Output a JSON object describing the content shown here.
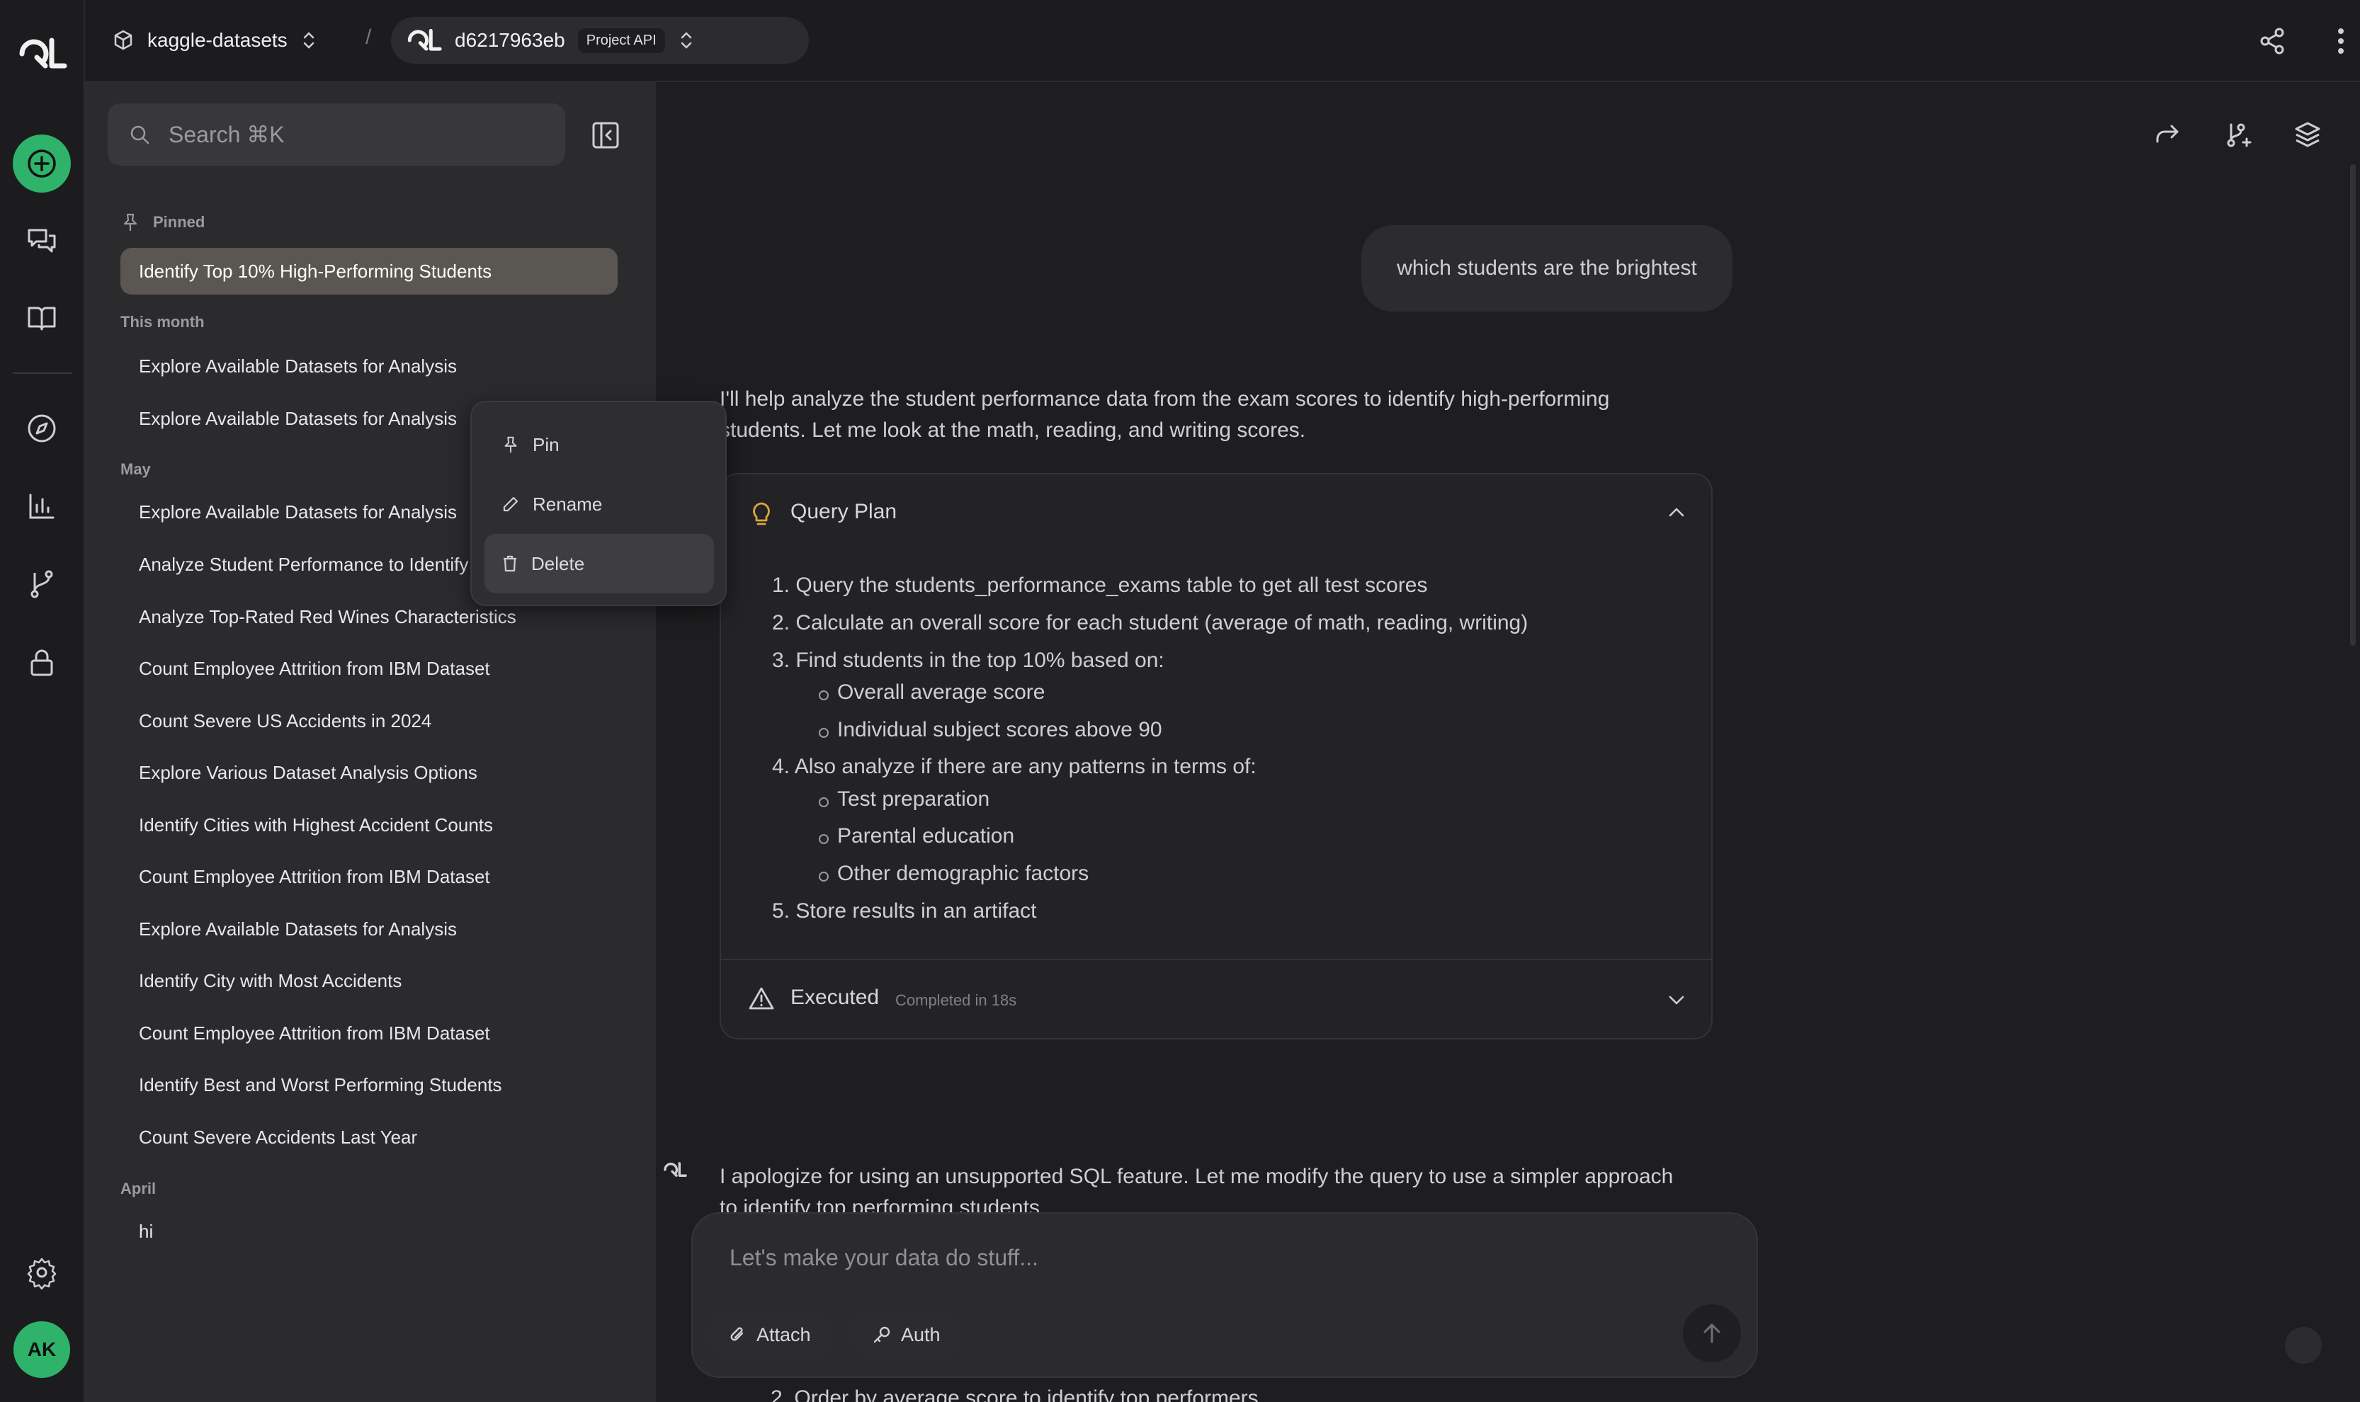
{
  "app": {
    "logo": "QL",
    "avatar_initials": "AK"
  },
  "topbar": {
    "project": "kaggle-datasets",
    "separator": "/",
    "connection_id": "d6217963eb",
    "connection_badge": "Project API"
  },
  "sidebar": {
    "search_placeholder": "Search ⌘K",
    "pinned_label": "Pinned",
    "pinned": [
      "Identify Top 10% High-Performing Students"
    ],
    "groups": [
      {
        "label": "This month",
        "items": [
          "Explore Available Datasets for Analysis",
          "Explore Available Datasets for Analysis"
        ]
      },
      {
        "label": "May",
        "items": [
          "Explore Available Datasets for Analysis",
          "Analyze Student Performance to Identify",
          "Analyze Top-Rated Red Wines Characteristics",
          "Count Employee Attrition from IBM Dataset",
          "Count Severe US Accidents in 2024",
          "Explore Various Dataset Analysis Options",
          "Identify Cities with Highest Accident Counts",
          "Count Employee Attrition from IBM Dataset",
          "Explore Available Datasets for Analysis",
          "Identify City with Most Accidents",
          "Count Employee Attrition from IBM Dataset",
          "Identify Best and Worst Performing Students",
          "Count Severe Accidents Last Year"
        ]
      },
      {
        "label": "April",
        "items": [
          "hi"
        ]
      }
    ]
  },
  "context_menu": {
    "pin": "Pin",
    "rename": "Rename",
    "delete": "Delete"
  },
  "chat": {
    "user_message": "which students are the brightest",
    "assistant_intro_line1": "I'll help analyze the student performance data from the exam scores to identify high-performing",
    "assistant_intro_line2": "students. Let me look at the math, reading, and writing scores.",
    "query_plan": {
      "title": "Query Plan",
      "steps": [
        "1. Query the students_performance_exams table to get all test scores",
        "2. Calculate an overall score for each student (average of math, reading, writing)",
        "3. Find students in the top 10% based on:",
        "4. Also analyze if there are any patterns in terms of:",
        "5. Store results in an artifact"
      ],
      "sub3": [
        "Overall average score",
        "Individual subject scores above 90"
      ],
      "sub4": [
        "Test preparation",
        "Parental education",
        "Other demographic factors"
      ]
    },
    "executed": {
      "title": "Executed",
      "status": "Completed in 18s"
    },
    "assistant_reply_line1": "I apologize for using an unsupported SQL feature. Let me modify the query to use a simpler approach",
    "assistant_reply_line2": "to identify top performing students",
    "peek_line": "2. Order by average score to identify top performers"
  },
  "composer": {
    "placeholder": "Let's make your data do stuff...",
    "attach": "Attach",
    "auth": "Auth"
  },
  "colors": {
    "accent": "#2fb36b",
    "sidebar_bg": "#2b2b2e",
    "main_bg": "#1e1e20",
    "active_item": "#5a5753"
  }
}
